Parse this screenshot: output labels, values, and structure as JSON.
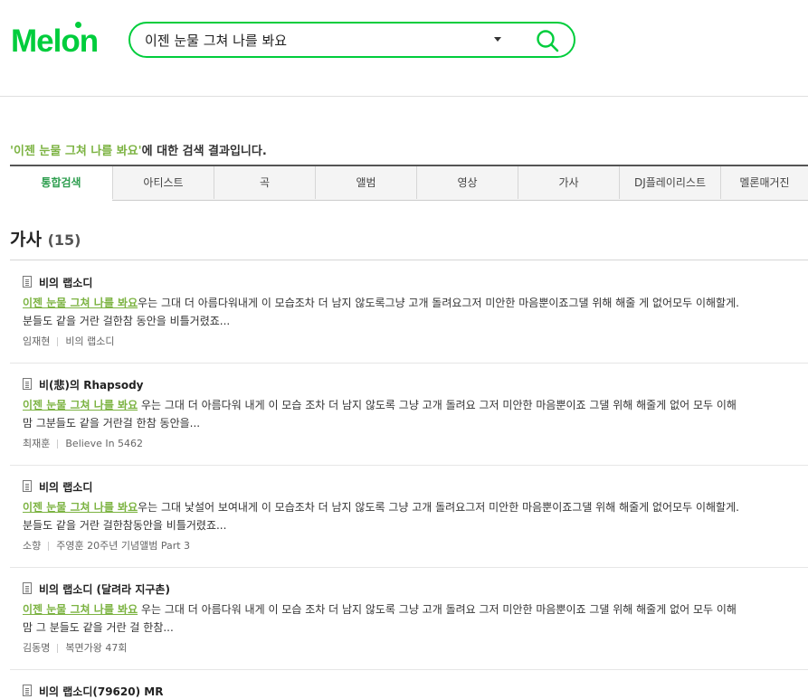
{
  "brand": {
    "logo_prefix": "Mel",
    "logo_o": "o",
    "logo_suffix": "n",
    "color": "#00cd3c"
  },
  "search": {
    "value": "이젠 눈물 그쳐 나를 봐요"
  },
  "result_header": {
    "query_quoted": "'이젠 눈물 그쳐 나를 봐요'",
    "suffix": "에 대한 검색 결과입니다."
  },
  "tabs": [
    "통합검색",
    "아티스트",
    "곡",
    "앨범",
    "영상",
    "가사",
    "DJ플레이리스트",
    "멜론매거진"
  ],
  "section": {
    "title": "가사",
    "count": "(15)"
  },
  "results": [
    {
      "title": "비의 랩소디",
      "highlight": "이젠 눈물 그쳐 나를 봐요",
      "lyric_rest": "우는 그대 더 아름다워내게 이 모습조차 더 남지 않도록그냥 고개 돌려요그저 미안한 마음뿐이죠그댈 위해 해줄 게 없어모두 이해할게.",
      "lyric_line2": "분들도 같을 거란 걸한참 동안을 비틀거렸죠...",
      "artist": "임재현",
      "album": "비의 랩소디"
    },
    {
      "title": "비(悲)의 Rhapsody",
      "highlight": "이젠 눈물 그쳐 나를 봐요",
      "lyric_rest": " 우는 그대 더 아름다워 내게 이 모습 조차 더 남지 않도록 그냥 고개 돌려요 그저 미안한 마음뿐이죠 그댈 위해 해줄게 없어 모두 이해",
      "lyric_line2": "맘 그분들도 같을 거란걸 한참 동안을...",
      "artist": "최재훈",
      "album": "Believe In 5462"
    },
    {
      "title": "비의 랩소디",
      "highlight": "이젠 눈물 그쳐 나를 봐요",
      "lyric_rest": "우는 그대 낯설어 보여내게 이 모습조차 더 남지 않도록 그냥 고개 돌려요그저 미안한 마음뿐이죠그댈 위해 해줄게 없어모두 이해할게.",
      "lyric_line2": "분들도 같을 거란 걸한참동안을 비틀거렸죠...",
      "artist": "소향",
      "album": "주영훈 20주년 기념앨범 Part 3"
    },
    {
      "title": "비의 랩소디 (달려라 지구촌)",
      "highlight": "이젠 눈물 그쳐 나를 봐요",
      "lyric_rest": " 우는 그대 더 아름다워 내게 이 모습 조차 더 남지 않도록 그냥 고개 돌려요 그저 미안한 마음뿐이죠 그댈 위해 해줄게 없어 모두 이해",
      "lyric_line2": "맘 그 분들도 같을 거란 걸 한참...",
      "artist": "김동명",
      "album": "복면가왕 47회"
    }
  ],
  "partial_next_title": "비의 랩소디(79620) MR"
}
